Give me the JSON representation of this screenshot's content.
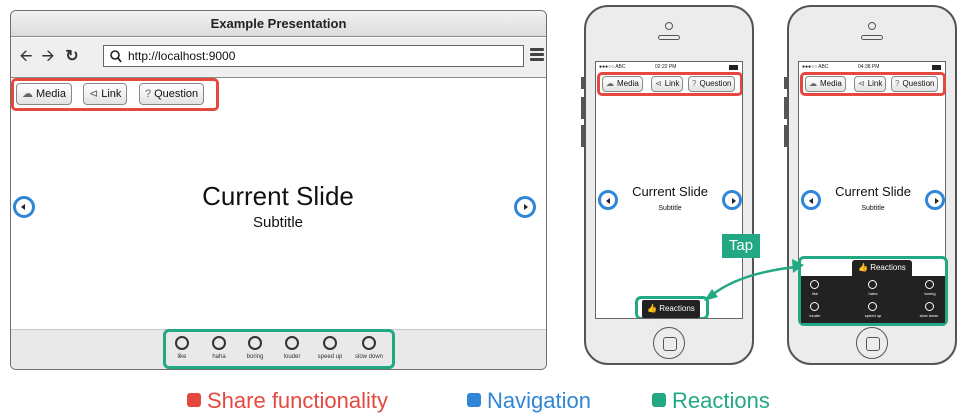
{
  "browser": {
    "title": "Example Presentation",
    "url": "http://localhost:9000",
    "nav_icons": [
      "back-arrow-icon",
      "forward-arrow-icon",
      "reload-icon",
      "search-icon",
      "hamburger-menu-icon"
    ]
  },
  "share_buttons": [
    {
      "label": "Media",
      "icon": "cloud-upload-icon"
    },
    {
      "label": "Link",
      "icon": "share-icon"
    },
    {
      "label": "Question",
      "icon": "question-icon"
    }
  ],
  "slide": {
    "title": "Current Slide",
    "subtitle": "Subtitle"
  },
  "reactions": [
    "like",
    "haha",
    "boring",
    "louder",
    "speed up",
    "slow down"
  ],
  "phones": [
    {
      "status_left": "●●●○○ ABC",
      "status_time": "02:22 PM"
    },
    {
      "status_left": "●●●○○ ABC",
      "status_time": "04:38 PM"
    }
  ],
  "reactions_button_label": "Reactions",
  "tap_label": "Tap",
  "legend": [
    {
      "label": "Share functionality",
      "color": "#e5483e"
    },
    {
      "label": "Navigation",
      "color": "#2f86d6"
    },
    {
      "label": "Reactions",
      "color": "#22a882"
    }
  ],
  "colors": {
    "share": "#e5483e",
    "navigation": "#2f86d6",
    "reactions": "#22a882"
  }
}
